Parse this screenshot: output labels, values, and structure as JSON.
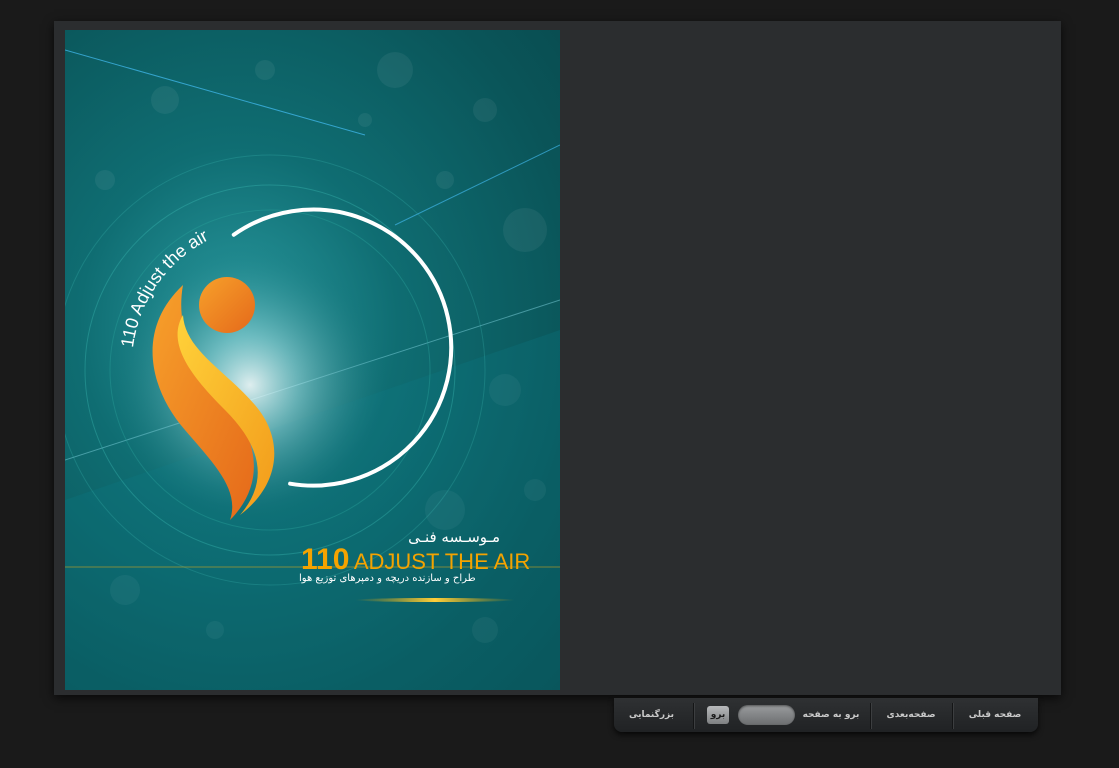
{
  "cover": {
    "ring_text": "110 Adjust the air",
    "title_fa": "مـوسـسه فنـی",
    "brand_number": "110",
    "brand_text": "ADJUST THE AIR",
    "subtitle_fa": "طراح و سازنده دریچه و دمپرهای توزیع هوا"
  },
  "toolbar": {
    "prev_label": "صفحه قبلی",
    "next_label": "صفحه‌بعدی",
    "goto_label": "برو به صفحه",
    "page_value": "",
    "go_label": "برو",
    "zoom_label": "بزرگنمایی"
  },
  "colors": {
    "background": "#1a1a1a",
    "viewer": "#2b2d2f",
    "teal": "#0f6d72",
    "orange": "#f08a1c",
    "gold": "#f4a300"
  }
}
